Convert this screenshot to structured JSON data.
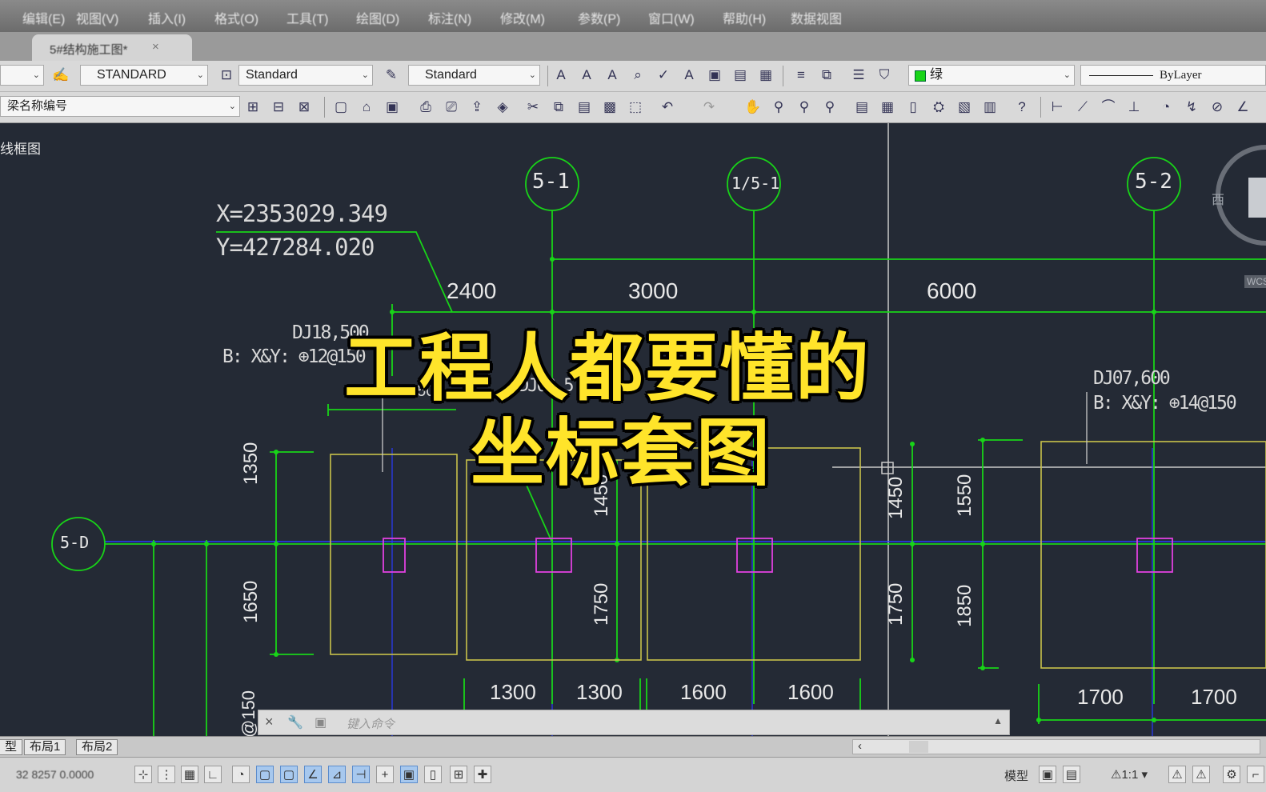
{
  "menu": [
    "编辑(E)",
    "视图(V)",
    "插入(I)",
    "格式(O)",
    "工具(T)",
    "绘图(D)",
    "标注(N)",
    "修改(M)",
    "参数(P)",
    "窗口(W)",
    "帮助(H)",
    "数据视图"
  ],
  "document_tab": {
    "title": "5#结构施工图*",
    "close": "×"
  },
  "toolbar": {
    "text_style": "STANDARD",
    "dim_style": "Standard",
    "table_style": "Standard",
    "layer_color": "绿",
    "linetype": "ByLayer",
    "beam_name": "梁名称编号"
  },
  "viewport_label": "线框图",
  "view_cube": {
    "west": "西",
    "wcs": "WCS"
  },
  "drawing": {
    "axes_top": [
      "5-1",
      "1/5-1",
      "5-2"
    ],
    "axis_left": "5-D",
    "coordinate": {
      "x": "X=2353029.349",
      "y": "Y=427284.020"
    },
    "top_dims": [
      "2400",
      "3000",
      "6000"
    ],
    "footing_a": {
      "name": "DJ18,500",
      "rebar": "B: X&Y:",
      "rebar_spec": "12@150"
    },
    "footing_b": {
      "name": "DJ07,600",
      "rebar": "B: X&Y:",
      "rebar_spec": "14@150"
    },
    "footing_c_partial": "DJ03,5",
    "small_dims": [
      "950",
      "950"
    ],
    "vertical_dims": [
      "1350",
      "1650",
      "1450",
      "1750",
      "1450",
      "1750",
      "1550",
      "1850"
    ],
    "bottom_dims": [
      "1300",
      "1300",
      "1600",
      "1600",
      "1700",
      "1700"
    ],
    "clipped_label": "@150"
  },
  "overlay": {
    "line1": "工程人都要懂的",
    "line2": "坐标套图"
  },
  "command": {
    "placeholder": "键入命令",
    "close": "×"
  },
  "layout_tabs": [
    "型",
    "布局1",
    "布局2"
  ],
  "status": {
    "coords": "32 8257  0.0000",
    "model": "模型",
    "scale": "1:1"
  },
  "colors": {
    "axis_line": "#18d418",
    "column": "#e040e0",
    "footing": "#c8c24a",
    "center_line": "#2a3cff",
    "text": "#e8e8e8",
    "background": "#242a35",
    "overlay_text": "#ffe42a"
  }
}
